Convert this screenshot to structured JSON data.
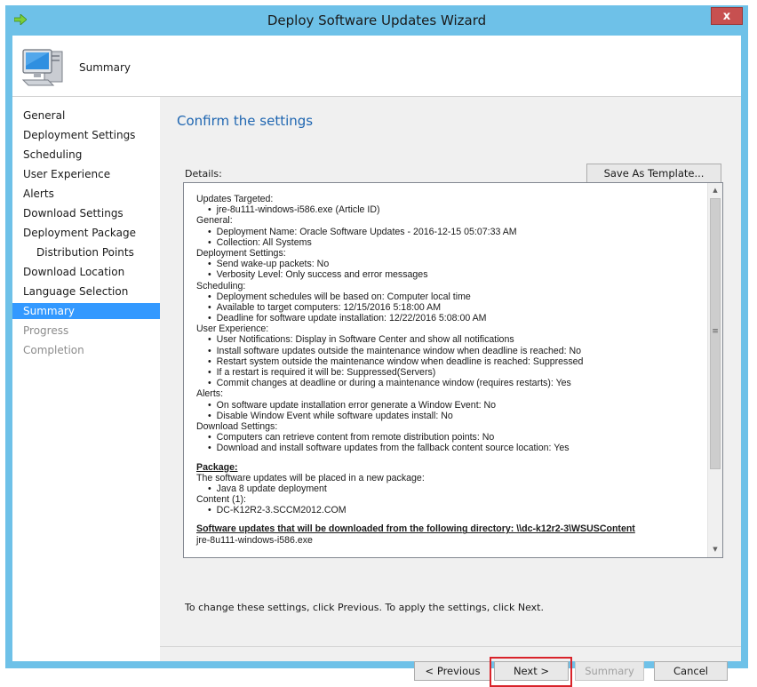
{
  "window": {
    "title": "Deploy Software Updates Wizard",
    "close_glyph": "x"
  },
  "header": {
    "title": "Summary"
  },
  "nav": {
    "items": [
      {
        "label": "General",
        "state": "normal"
      },
      {
        "label": "Deployment Settings",
        "state": "normal"
      },
      {
        "label": "Scheduling",
        "state": "normal"
      },
      {
        "label": "User Experience",
        "state": "normal"
      },
      {
        "label": "Alerts",
        "state": "normal"
      },
      {
        "label": "Download Settings",
        "state": "normal"
      },
      {
        "label": "Deployment Package",
        "state": "normal"
      },
      {
        "label": "Distribution Points",
        "state": "normal"
      },
      {
        "label": "Download Location",
        "state": "normal"
      },
      {
        "label": "Language Selection",
        "state": "normal"
      },
      {
        "label": "Summary",
        "state": "selected"
      },
      {
        "label": "Progress",
        "state": "disabled"
      },
      {
        "label": "Completion",
        "state": "disabled"
      }
    ]
  },
  "main": {
    "heading": "Confirm the settings",
    "details_label": "Details:",
    "save_template_label": "Save As Template...",
    "details": {
      "updates_targeted": "Updates Targeted:",
      "update_item": "jre-8u111-windows-i586.exe (Article ID)",
      "general": "General:",
      "deployment_name": "Deployment Name: Oracle Software Updates - 2016-12-15 05:07:33 AM",
      "collection": "Collection: All Systems",
      "deployment_settings": "Deployment Settings:",
      "wake_up": "Send wake-up packets: No",
      "verbosity": "Verbosity Level: Only success and error messages",
      "scheduling": "Scheduling:",
      "schedule_basis": "Deployment schedules will be based on: Computer local time",
      "available": "Available to target computers: 12/15/2016 5:18:00 AM",
      "deadline": "Deadline for software update installation: 12/22/2016 5:08:00 AM",
      "user_experience": "User Experience:",
      "user_notifications": "User Notifications: Display in Software Center and show all notifications",
      "install_outside": "Install software updates outside the maintenance window when deadline is reached: No",
      "restart_outside": "Restart system outside the maintenance window when deadline is reached: Suppressed",
      "restart_required": "If a restart is required it will be: Suppressed(Servers)",
      "commit_changes": "Commit changes at deadline or during a maintenance window (requires restarts): Yes",
      "alerts": "Alerts:",
      "alert_error": "On software update installation error generate a Window Event: No",
      "alert_disable": "Disable Window Event while software updates install: No",
      "download_settings": "Download Settings:",
      "remote_dp": "Computers can retrieve content from remote distribution points: No",
      "fallback": "Download and install software updates from the fallback content source location: Yes",
      "package_heading": "Package:",
      "package_placed": "The software updates will be placed in a new package:",
      "package_name": "Java 8 update deployment",
      "content_count": "Content (1):",
      "content_server": "DC-K12R2-3.SCCM2012.COM",
      "download_dir_heading": "Software updates that will be downloaded from the following directory: \\\\dc-k12r2-3\\WSUSContent",
      "download_file": "jre-8u111-windows-i586.exe"
    },
    "instructions": "To change these settings, click Previous. To apply the settings, click Next."
  },
  "footer": {
    "previous_label": "< Previous",
    "next_label": "Next >",
    "summary_label": "Summary",
    "cancel_label": "Cancel"
  },
  "colors": {
    "titlebar": "#6ec1e8",
    "selected_nav": "#3399ff",
    "heading": "#1f66b1",
    "highlight": "#d9232a"
  }
}
